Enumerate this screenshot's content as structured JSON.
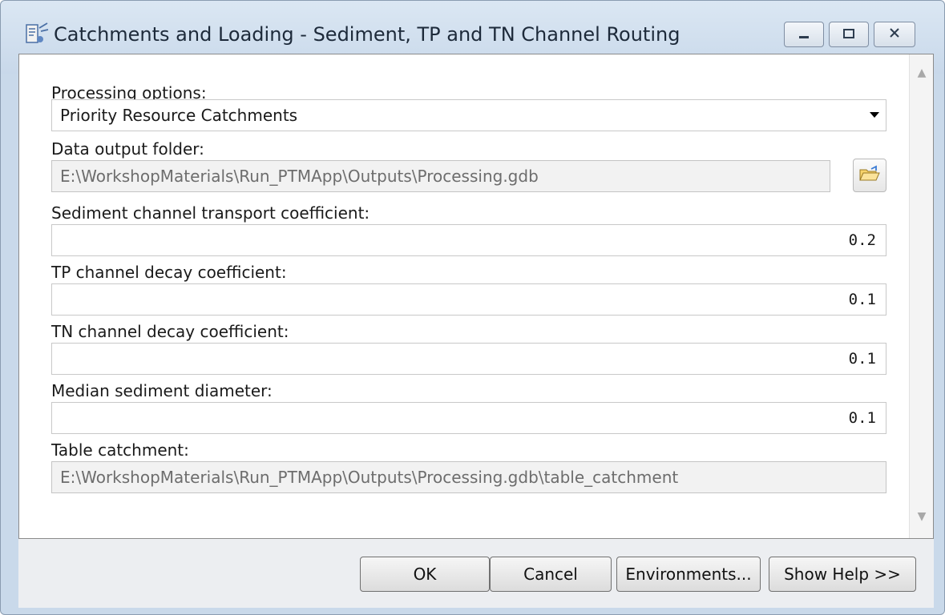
{
  "window": {
    "title": "Catchments and Loading - Sediment, TP and TN Channel Routing",
    "icon": "tool-icon",
    "controls": {
      "minimize_icon": "minimize-icon",
      "maximize_icon": "maximize-icon",
      "close_icon": "close-icon"
    }
  },
  "form": {
    "processing_options": {
      "label": "Processing options:",
      "value": "Priority Resource Catchments"
    },
    "data_output_folder": {
      "label": "Data output folder:",
      "value": "E:\\WorkshopMaterials\\Run_PTMApp\\Outputs\\Processing.gdb"
    },
    "sediment_coeff": {
      "label": "Sediment channel transport coefficient:",
      "value": "0.2"
    },
    "tp_decay": {
      "label": "TP channel decay coefficient:",
      "value": "0.1"
    },
    "tn_decay": {
      "label": "TN channel decay coefficient:",
      "value": "0.1"
    },
    "median_diameter": {
      "label": "Median sediment diameter:",
      "value": "0.1"
    },
    "table_catchment": {
      "label": "Table catchment:",
      "value": "E:\\WorkshopMaterials\\Run_PTMApp\\Outputs\\Processing.gdb\\table_catchment"
    }
  },
  "buttons": {
    "ok": "OK",
    "cancel": "Cancel",
    "environments": "Environments...",
    "show_help": "Show Help >>"
  },
  "colors": {
    "titlebar": "#c8d8ea",
    "readonly_field": "#f2f2f2",
    "footer": "#eceef1"
  }
}
